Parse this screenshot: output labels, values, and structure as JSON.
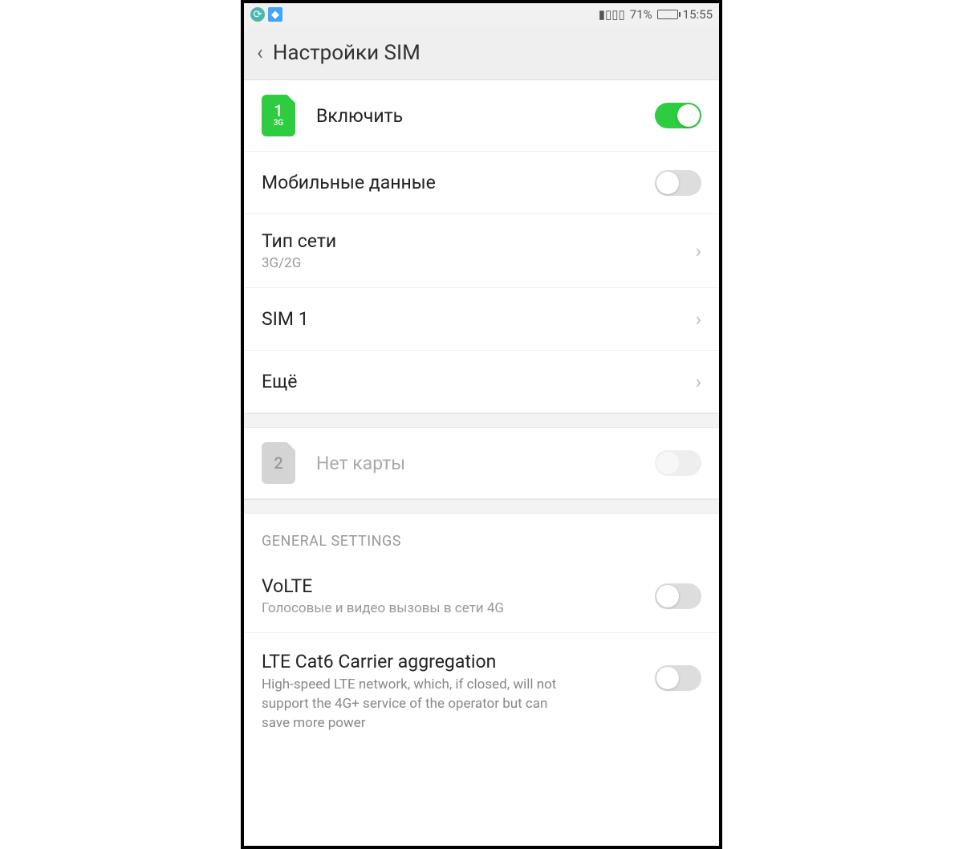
{
  "status_bar": {
    "battery_pct": "71%",
    "time": "15:55"
  },
  "header": {
    "title": "Настройки SIM"
  },
  "sim1": {
    "number": "1",
    "badge": "3G",
    "label": "Включить"
  },
  "rows": {
    "mobile_data": "Мобильные данные",
    "network_type": "Тип сети",
    "network_type_value": "3G/2G",
    "sim1_entry": "SIM 1",
    "more": "Ещё"
  },
  "sim2": {
    "number": "2",
    "label": "Нет карты"
  },
  "general": {
    "heading": "GENERAL SETTINGS",
    "volte_title": "VoLTE",
    "volte_sub": "Голосовые и видео вызовы в сети 4G",
    "lte_title": "LTE Cat6 Carrier aggregation",
    "lte_sub": "High-speed LTE network, which, if closed, will not support the 4G+ service of the operator but can save more power"
  }
}
